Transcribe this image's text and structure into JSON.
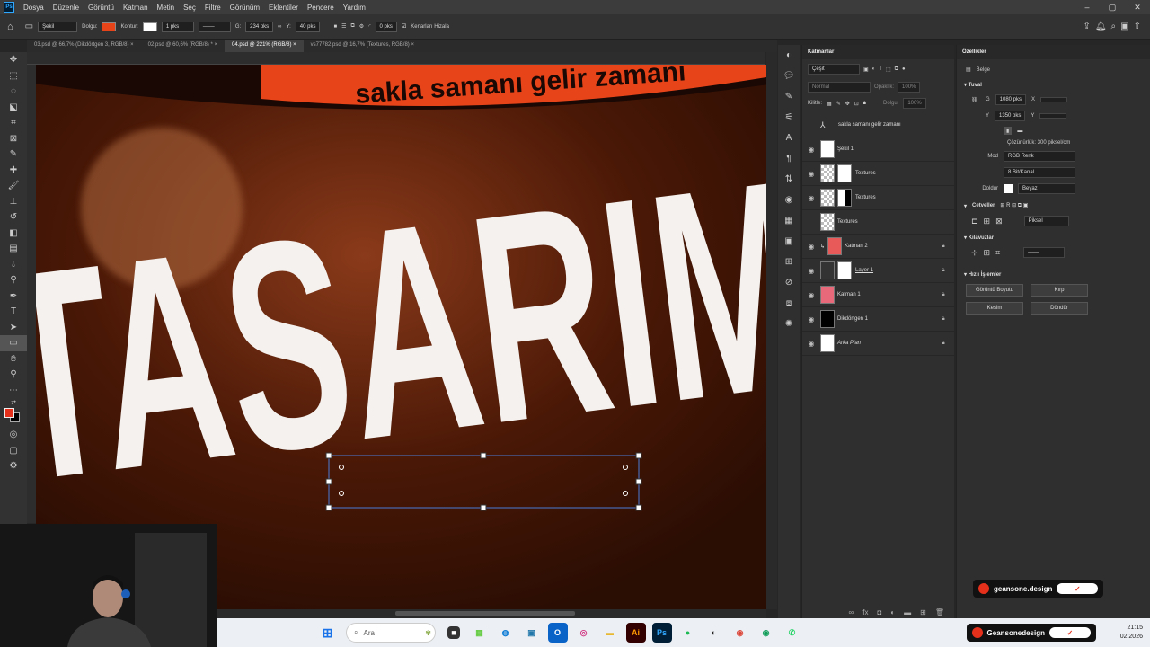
{
  "menu": {
    "items": [
      "Dosya",
      "Düzenle",
      "Görüntü",
      "Katman",
      "Metin",
      "Seç",
      "Filtre",
      "Görünüm",
      "Eklentiler",
      "Pencere",
      "Yardım"
    ]
  },
  "options": {
    "shape_mode": "Şekil",
    "fill_label": "Dolgu:",
    "fill_color": "#e8441a",
    "stroke_label": "Kontur:",
    "stroke_width": "1 pks",
    "w_label": "G:",
    "width": "234 pks",
    "h_label": "Y:",
    "height": "40 pks",
    "radius": "0 pks",
    "align_edges": "Kenarları Hizala"
  },
  "tabs": [
    "03.psd @ 66,7% (Dikdörtgen 3, RGB/8)",
    "02.psd @ 60,6% (RGB/8) *",
    "04.psd @ 221% (RGB/8)",
    "vs77782.psd @ 16,7% (Textures, RGB/8)"
  ],
  "canvas": {
    "banner_text": "sakla samanı gelir zamanı",
    "headline": "TASARIM",
    "bg_color": "#3a1205",
    "accent_color": "#e8441a"
  },
  "layers": {
    "title": "Katmanlar",
    "filter": "Çeşit",
    "blend": "Normal",
    "opacity_label": "Opaklık:",
    "opacity": "100%",
    "lock_label": "Kilitle:",
    "fill_label": "Dolgu:",
    "fill": "100%",
    "items": [
      {
        "name": "sakla samanı gelir zamanı"
      },
      {
        "name": "Şekil 1"
      },
      {
        "name": "Textures"
      },
      {
        "name": "Textures"
      },
      {
        "name": "Textures"
      },
      {
        "name": "Katman 2"
      },
      {
        "name": "Layer 1"
      },
      {
        "name": "Katman 1"
      },
      {
        "name": "Dikdörtgen 1"
      },
      {
        "name": "Arka Plan"
      }
    ]
  },
  "properties": {
    "title": "Özellikler",
    "doc_label": "Belge",
    "canvas_section": "Tuval",
    "w_label": "G",
    "width": "1080 pks",
    "h_label": "Y",
    "height": "1350 pks",
    "x_label": "X",
    "y_label": "Y",
    "resolution": "Çözünürlük: 300 piksel/cm",
    "mode_label": "Mod",
    "mode": "RGB Renk",
    "depth": "8 Bit/Kanal",
    "fill_label": "Doldur",
    "fill": "Beyaz",
    "rulers_section": "Cetveller",
    "ruler_unit": "Piksel",
    "guides_section": "Kılavuzlar",
    "quick_section": "Hızlı İşlemler",
    "btn_image_size": "Görüntü Boyutu",
    "btn_crop": "Kırp",
    "btn_trim": "Kesim",
    "btn_rotate": "Döndür"
  },
  "taskbar": {
    "search": "Ara",
    "time": "21:15",
    "date": "02.2026",
    "brand_small": "geansone.design",
    "brand_big": "Geansonedesign"
  }
}
